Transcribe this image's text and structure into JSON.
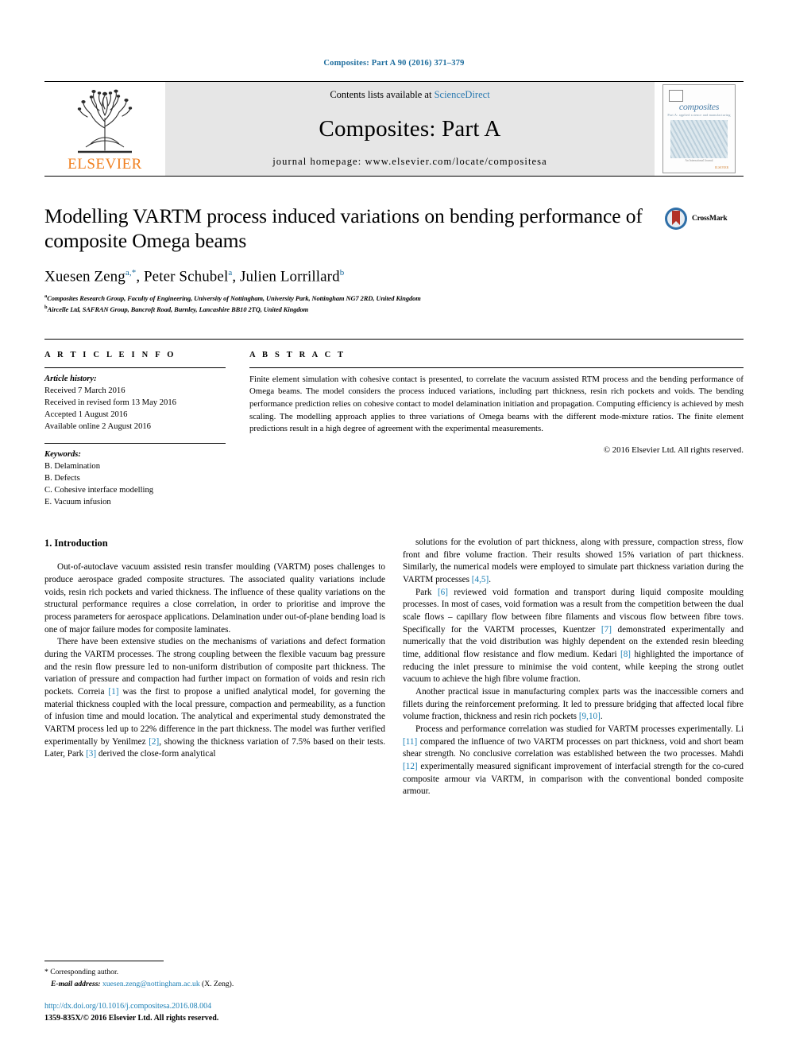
{
  "running_head": "Composites: Part A 90 (2016) 371–379",
  "masthead": {
    "publisher": "ELSEVIER",
    "contents_prefix": "Contents lists available at ",
    "contents_link": "ScienceDirect",
    "journal_title": "Composites: Part A",
    "homepage": "journal homepage: www.elsevier.com/locate/compositesa",
    "cover": {
      "title": "composites",
      "subtitle": "Part A: applied science and manufacturing",
      "footer_small": "An International Journal",
      "footer_brand": "ELSEVIER"
    }
  },
  "article": {
    "title": "Modelling VARTM process induced variations on bending performance of composite Omega beams",
    "crossmark_label": "CrossMark",
    "authors": [
      {
        "name": "Xuesen Zeng",
        "marks": "a,*"
      },
      {
        "name": "Peter Schubel",
        "marks": "a"
      },
      {
        "name": "Julien Lorrillard",
        "marks": "b"
      }
    ],
    "affiliations": [
      {
        "mark": "a",
        "text": "Composites Research Group, Faculty of Engineering, University of Nottingham, University Park, Nottingham NG7 2RD, United Kingdom"
      },
      {
        "mark": "b",
        "text": "Aircelle Ltd, SAFRAN Group, Bancroft Road, Burnley, Lancashire BB10 2TQ, United Kingdom"
      }
    ]
  },
  "info": {
    "heading": "A R T I C L E   I N F O",
    "history_label": "Article history:",
    "history": [
      "Received 7 March 2016",
      "Received in revised form 13 May 2016",
      "Accepted 1 August 2016",
      "Available online 2 August 2016"
    ],
    "keywords_label": "Keywords:",
    "keywords": [
      "B. Delamination",
      "B. Defects",
      "C. Cohesive interface modelling",
      "E. Vacuum infusion"
    ]
  },
  "abstract": {
    "heading": "A B S T R A C T",
    "body": "Finite element simulation with cohesive contact is presented, to correlate the vacuum assisted RTM process and the bending performance of Omega beams. The model considers the process induced variations, including part thickness, resin rich pockets and voids. The bending performance prediction relies on cohesive contact to model delamination initiation and propagation. Computing efficiency is achieved by mesh scaling. The modelling approach applies to three variations of Omega beams with the different mode-mixture ratios. The finite element predictions result in a high degree of agreement with the experimental measurements.",
    "copyright": "© 2016 Elsevier Ltd. All rights reserved."
  },
  "body": {
    "section_number_title": "1. Introduction",
    "left_paragraphs": [
      "Out-of-autoclave vacuum assisted resin transfer moulding (VARTM) poses challenges to produce aerospace graded composite structures. The associated quality variations include voids, resin rich pockets and varied thickness. The influence of these quality variations on the structural performance requires a close correlation, in order to prioritise and improve the process parameters for aerospace applications. Delamination under out-of-plane bending load is one of major failure modes for composite laminates.",
      "There have been extensive studies on the mechanisms of variations and defect formation during the VARTM processes. The strong coupling between the flexible vacuum bag pressure and the resin flow pressure led to non-uniform distribution of composite part thickness. The variation of pressure and compaction had further impact on formation of voids and resin rich pockets. Correia [1] was the first to propose a unified analytical model, for governing the material thickness coupled with the local pressure, compaction and permeability, as a function of infusion time and mould location. The analytical and experimental study demonstrated the VARTM process led up to 22% difference in the part thickness. The model was further verified experimentally by Yenilmez [2], showing the thickness variation of 7.5% based on their tests. Later, Park [3] derived the close-form analytical"
    ],
    "right_paragraphs": [
      "solutions for the evolution of part thickness, along with pressure, compaction stress, flow front and fibre volume fraction. Their results showed 15% variation of part thickness. Similarly, the numerical models were employed to simulate part thickness variation during the VARTM processes [4,5].",
      "Park [6] reviewed void formation and transport during liquid composite moulding processes. In most of cases, void formation was a result from the competition between the dual scale flows – capillary flow between fibre filaments and viscous flow between fibre tows. Specifically for the VARTM processes, Kuentzer [7] demonstrated experimentally and numerically that the void distribution was highly dependent on the extended resin bleeding time, additional flow resistance and flow medium. Kedari [8] highlighted the importance of reducing the inlet pressure to minimise the void content, while keeping the strong outlet vacuum to achieve the high fibre volume fraction.",
      "Another practical issue in manufacturing complex parts was the inaccessible corners and fillets during the reinforcement preforming. It led to pressure bridging that affected local fibre volume fraction, thickness and resin rich pockets [9,10].",
      "Process and performance correlation was studied for VARTM processes experimentally. Li [11] compared the influence of two VARTM processes on part thickness, void and short beam shear strength. No conclusive correlation was established between the two processes. Mahdi [12] experimentally measured significant improvement of interfacial strength for the co-cured composite armour via VARTM, in comparison with the conventional bonded composite armour."
    ]
  },
  "footnote": {
    "corresponding_mark": "*",
    "corresponding_text": "Corresponding author.",
    "email_label": "E-mail address:",
    "email": "xuesen.zeng@nottingham.ac.uk",
    "email_suffix": "(X. Zeng).",
    "doi": "http://dx.doi.org/10.1016/j.compositesa.2016.08.004",
    "issn_line": "1359-835X/© 2016 Elsevier Ltd. All rights reserved."
  },
  "colors": {
    "link": "#1b7fb5",
    "running_head": "#1b6b9c",
    "elsevier_orange": "#f08020",
    "crossmark_blue": "#2f6fa8",
    "crossmark_red": "#b33228"
  }
}
